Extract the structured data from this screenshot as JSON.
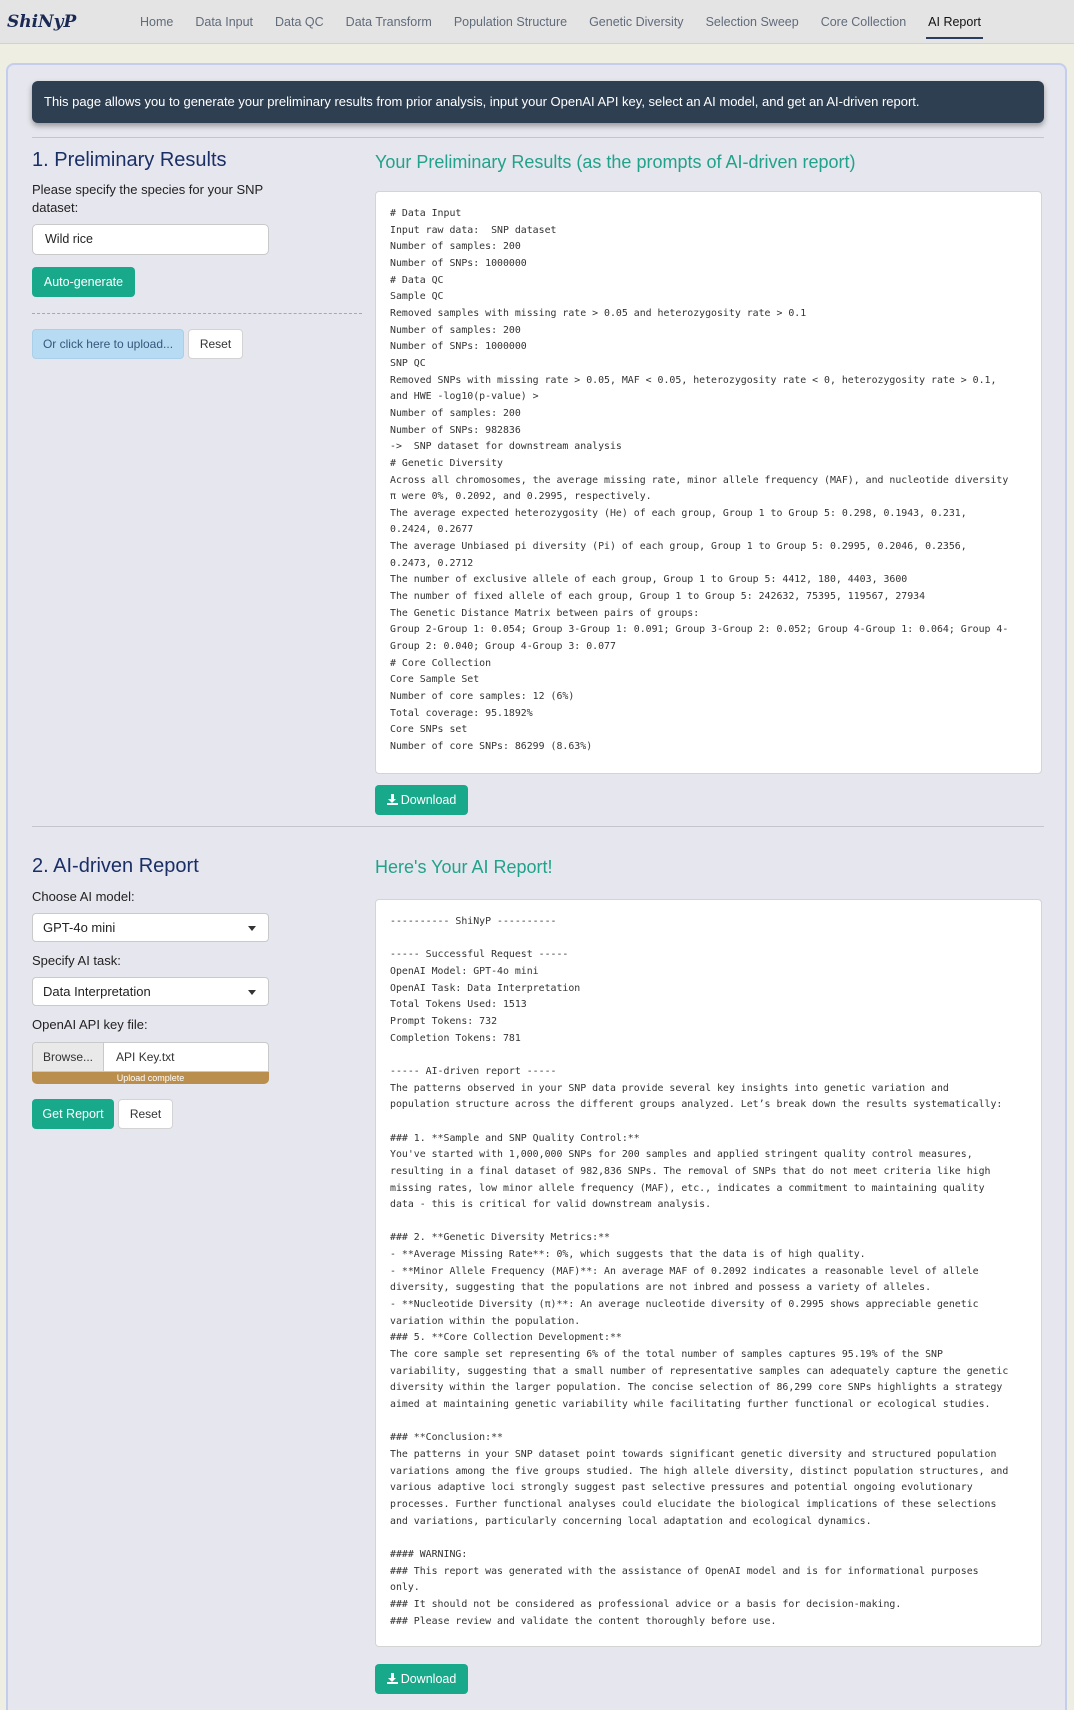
{
  "navbar": {
    "brand": "ShiNyP",
    "items": [
      {
        "label": "Home"
      },
      {
        "label": "Data Input"
      },
      {
        "label": "Data QC"
      },
      {
        "label": "Data Transform"
      },
      {
        "label": "Population Structure"
      },
      {
        "label": "Genetic Diversity"
      },
      {
        "label": "Selection Sweep"
      },
      {
        "label": "Core Collection"
      },
      {
        "label": "AI Report",
        "active": true
      }
    ]
  },
  "banner": "This page allows you to generate your preliminary results from prior analysis, input your OpenAI API key, select an AI model, and get an AI-driven report.",
  "section1": {
    "title": "1. Preliminary Results",
    "species_label": "Please specify the species for your SNP dataset:",
    "species_value": "Wild rice",
    "auto_generate": "Auto-generate",
    "upload_button": "Or click here to upload...",
    "reset_button": "Reset",
    "results_title": "Your Preliminary Results (as the prompts of AI-driven report)",
    "results_text": "# Data Input\nInput raw data:  SNP dataset\nNumber of samples: 200\nNumber of SNPs: 1000000\n# Data QC\nSample QC\nRemoved samples with missing rate > 0.05 and heterozygosity rate > 0.1\nNumber of samples: 200\nNumber of SNPs: 1000000\nSNP QC\nRemoved SNPs with missing rate > 0.05, MAF < 0.05, heterozygosity rate < 0, heterozygosity rate > 0.1,\nand HWE -log10(p-value) >\nNumber of samples: 200\nNumber of SNPs: 982836\n->  SNP dataset for downstream analysis\n# Genetic Diversity\nAcross all chromosomes, the average missing rate, minor allele frequency (MAF), and nucleotide diversity\nπ were 0%, 0.2092, and 0.2995, respectively.\nThe average expected heterozygosity (He) of each group, Group 1 to Group 5: 0.298, 0.1943, 0.231,\n0.2424, 0.2677\nThe average Unbiased pi diversity (Pi) of each group, Group 1 to Group 5: 0.2995, 0.2046, 0.2356,\n0.2473, 0.2712\nThe number of exclusive allele of each group, Group 1 to Group 5: 4412, 180, 4403, 3600\nThe number of fixed allele of each group, Group 1 to Group 5: 242632, 75395, 119567, 27934\nThe Genetic Distance Matrix between pairs of groups:\nGroup 2-Group 1: 0.054; Group 3-Group 1: 0.091; Group 3-Group 2: 0.052; Group 4-Group 1: 0.064; Group 4-\nGroup 2: 0.040; Group 4-Group 3: 0.077\n# Core Collection\nCore Sample Set\nNumber of core samples: 12 (6%)\nTotal coverage: 95.1892%\nCore SNPs set\nNumber of core SNPs: 86299 (8.63%)",
    "download": "Download"
  },
  "section2": {
    "title": "2. AI-driven Report",
    "model_label": "Choose AI model:",
    "model_value": "GPT-4o mini",
    "task_label": "Specify AI task:",
    "task_value": "Data Interpretation",
    "key_label": "OpenAI API key file:",
    "browse": "Browse...",
    "file_name": "API Key.txt",
    "upload_status": "Upload complete",
    "upload_progress": 1.0,
    "get_report": "Get Report",
    "reset_button": "Reset",
    "report_title": "Here's Your AI Report!",
    "report_text": "---------- ShiNyP ----------\n\n----- Successful Request -----\nOpenAI Model: GPT-4o mini\nOpenAI Task: Data Interpretation\nTotal Tokens Used: 1513\nPrompt Tokens: 732\nCompletion Tokens: 781\n\n----- AI-driven report -----\nThe patterns observed in your SNP data provide several key insights into genetic variation and\npopulation structure across the different groups analyzed. Let’s break down the results systematically:\n\n### 1. **Sample and SNP Quality Control:**\nYou've started with 1,000,000 SNPs for 200 samples and applied stringent quality control measures,\nresulting in a final dataset of 982,836 SNPs. The removal of SNPs that do not meet criteria like high\nmissing rates, low minor allele frequency (MAF), etc., indicates a commitment to maintaining quality\ndata - this is critical for valid downstream analysis.\n\n### 2. **Genetic Diversity Metrics:**\n- **Average Missing Rate**: 0%, which suggests that the data is of high quality.\n- **Minor Allele Frequency (MAF)**: An average MAF of 0.2092 indicates a reasonable level of allele\ndiversity, suggesting that the populations are not inbred and possess a variety of alleles.\n- **Nucleotide Diversity (π)**: An average nucleotide diversity of 0.2995 shows appreciable genetic\nvariation within the population.\n### 5. **Core Collection Development:**\nThe core sample set representing 6% of the total number of samples captures 95.19% of the SNP\nvariability, suggesting that a small number of representative samples can adequately capture the genetic\ndiversity within the larger population. The concise selection of 86,299 core SNPs highlights a strategy\naimed at maintaining genetic variability while facilitating further functional or ecological studies.\n\n### **Conclusion:**\nThe patterns in your SNP dataset point towards significant genetic diversity and structured population\nvariations among the five groups studied. The high allele diversity, distinct population structures, and\nvarious adaptive loci strongly suggest past selective pressures and potential ongoing evolutionary\nprocesses. Further functional analyses could elucidate the biological implications of these selections\nand variations, particularly concerning local adaptation and ecological dynamics.\n\n#### WARNING:\n### This report was generated with the assistance of OpenAI model and is for informational purposes\nonly.\n### It should not be considered as professional advice or a basis for decision-making.\n### Please review and validate the content thoroughly before use.",
    "download": "Download"
  },
  "colors": {
    "accent": "#18a98b",
    "heading": "#1a2f66",
    "banner": "#2f3f52",
    "progress": "#ba8e4c"
  }
}
